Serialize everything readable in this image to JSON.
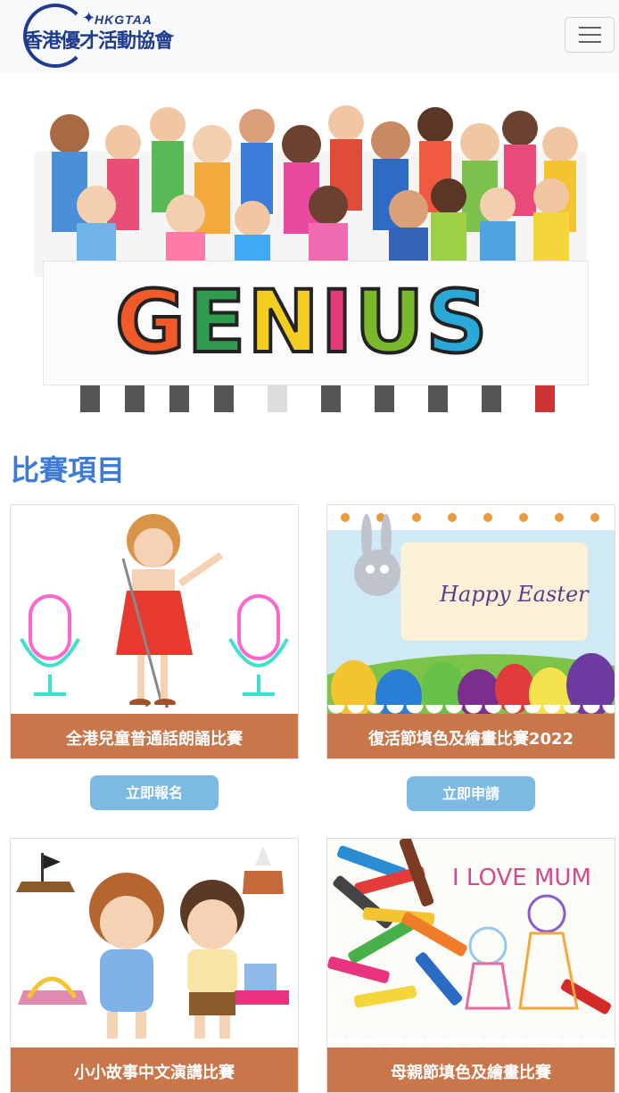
{
  "header": {
    "logo_en": "HKGTAA",
    "logo_zh": "香港優才活動協會",
    "menu_icon": "hamburger-icon"
  },
  "hero": {
    "banner_text": "GENIUS",
    "letter_colors": [
      "#f05a28",
      "#2e9b4f",
      "#f3cd1f",
      "#e5397b",
      "#7ab929",
      "#2aa9d8",
      "#e8347e"
    ]
  },
  "competitions": {
    "title": "比賽項目",
    "items": [
      {
        "label": "全港兒童普通話朗誦比賽",
        "button": "立即報名"
      },
      {
        "label": "復活節填色及繪畫比賽2022",
        "image_text": "Happy Easter",
        "button": "立即申請"
      },
      {
        "label": "小小故事中文演講比賽"
      },
      {
        "label": "母親節填色及繪畫比賽",
        "image_text": "I LOVE MUM"
      }
    ]
  },
  "colors": {
    "accent": "#3d7bd6",
    "button": "#7cb9e3",
    "label_bar": "#c9764a",
    "logo": "#1d3c8f"
  }
}
